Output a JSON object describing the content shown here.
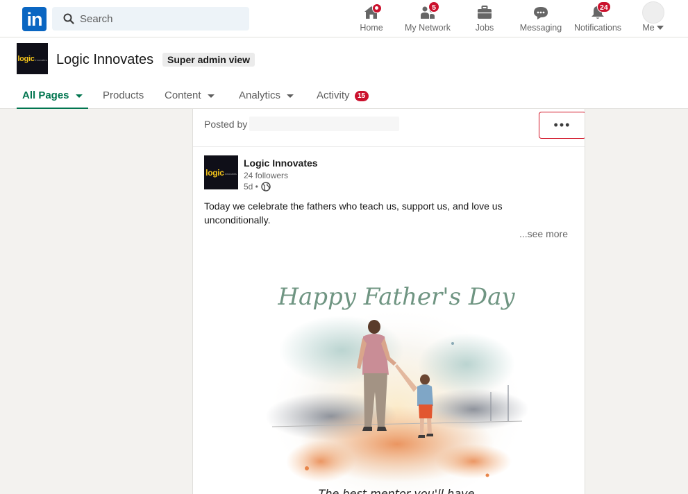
{
  "nav": {
    "logo_text": "in",
    "search_placeholder": "Search",
    "items": [
      {
        "label": "Home",
        "badge": ""
      },
      {
        "label": "My Network",
        "badge": "5"
      },
      {
        "label": "Jobs",
        "badge": ""
      },
      {
        "label": "Messaging",
        "badge": ""
      },
      {
        "label": "Notifications",
        "badge": "24"
      },
      {
        "label": "Me",
        "badge": ""
      }
    ]
  },
  "page": {
    "logo_text": "logic",
    "logo_sub": "innovates",
    "company_name": "Logic Innovates",
    "admin_chip": "Super admin view",
    "tabs": [
      {
        "label": "All Pages",
        "active": true
      },
      {
        "label": "Products"
      },
      {
        "label": "Content"
      },
      {
        "label": "Analytics"
      },
      {
        "label": "Activity",
        "badge": "15"
      }
    ]
  },
  "post": {
    "posted_by_label": "Posted by",
    "more_button": "•••",
    "actor_name": "Logic Innovates",
    "followers": "24 followers",
    "time": "5d •",
    "text": "Today we celebrate the fathers who teach us, support us, and love us unconditionally.",
    "see_more": "...see more",
    "image_title": "Happy Father's Day",
    "image_caption": "The best mentor you'll have"
  },
  "colors": {
    "brand_blue": "#0a66c2",
    "active_green": "#01754f",
    "badge_red": "#cb112d",
    "highlight_red": "#d11124"
  }
}
